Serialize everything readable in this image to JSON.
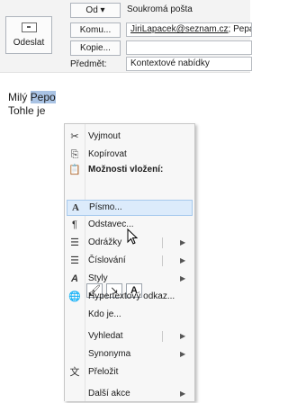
{
  "compose": {
    "send_label": "Odeslat",
    "od_label": "Od ▾",
    "from_value": "Soukromá pošta",
    "to_label": "Komu...",
    "to_value_link": "JiriLapacek@seznam.cz",
    "to_value_rest": "; Pepa",
    "cc_label": "Kopie...",
    "cc_value": "",
    "subject_label": "Předmět:",
    "subject_value": "Kontextové nabídky"
  },
  "body": {
    "line1_prefix": "Milý ",
    "line1_selected": "Pepo",
    "line2": "Tohle je"
  },
  "menu": {
    "cut": "Vyjmout",
    "copy": "Kopírovat",
    "paste_options": "Možnosti vložení:",
    "font": "Písmo...",
    "paragraph": "Odstavec...",
    "bullets": "Odrážky",
    "numbering": "Číslování",
    "styles": "Styly",
    "hyperlink": "Hypertextový odkaz...",
    "who_is": "Kdo je...",
    "find": "Vyhledat",
    "synonyms": "Synonyma",
    "translate": "Přeložit",
    "more_actions": "Další akce"
  }
}
